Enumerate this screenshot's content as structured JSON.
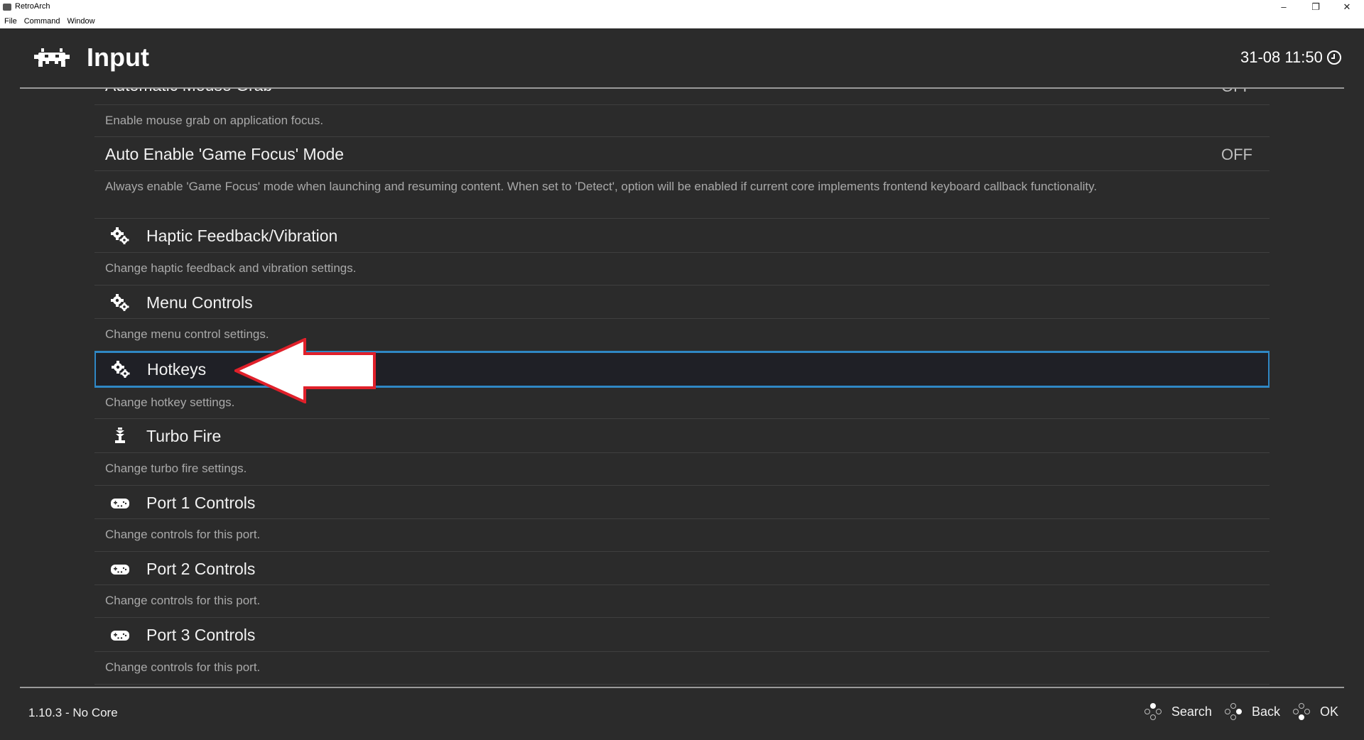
{
  "window": {
    "title": "RetroArch",
    "menu": [
      "File",
      "Command",
      "Window"
    ],
    "controls": {
      "minimize": "–",
      "maximize": "❐",
      "close": "✕"
    }
  },
  "header": {
    "title": "Input",
    "clock": "31-08 11:50",
    "logo_icon": "retroarch-invader-icon",
    "clock_icon": "clock-icon"
  },
  "list": {
    "items": [
      {
        "label": "Automatic Mouse Grab",
        "value": "OFF",
        "description": "Enable mouse grab on application focus.",
        "icon": null
      },
      {
        "label": "Auto Enable 'Game Focus' Mode",
        "value": "OFF",
        "description": "Always enable 'Game Focus' mode when launching and resuming content. When set to 'Detect', option will be enabled if current core implements frontend keyboard callback functionality.",
        "icon": null
      },
      {
        "label": "Haptic Feedback/Vibration",
        "description": "Change haptic feedback and vibration settings.",
        "icon": "gears-icon"
      },
      {
        "label": "Menu Controls",
        "description": "Change menu control settings.",
        "icon": "gears-icon"
      },
      {
        "label": "Hotkeys",
        "description": "Change hotkey settings.",
        "icon": "gears-icon",
        "selected": true
      },
      {
        "label": "Turbo Fire",
        "description": "Change turbo fire settings.",
        "icon": "turbo-icon"
      },
      {
        "label": "Port 1 Controls",
        "description": "Change controls for this port.",
        "icon": "gamepad-icon"
      },
      {
        "label": "Port 2 Controls",
        "description": "Change controls for this port.",
        "icon": "gamepad-icon"
      },
      {
        "label": "Port 3 Controls",
        "description": "Change controls for this port.",
        "icon": "gamepad-icon"
      }
    ]
  },
  "annotation": {
    "type": "red-outlined-arrow",
    "points_to": "Hotkeys",
    "colors": {
      "fill": "#ffffff",
      "stroke": "#e0202a"
    }
  },
  "footer": {
    "version": "1.10.3 - No Core",
    "actions": [
      {
        "label": "Search",
        "icon": "gamepad-button-top-icon"
      },
      {
        "label": "Back",
        "icon": "gamepad-button-right-icon"
      },
      {
        "label": "OK",
        "icon": "gamepad-button-bottom-icon"
      }
    ]
  },
  "colors": {
    "background": "#2b2b2b",
    "selection_border": "#2f87c4",
    "selection_bg": "#1f2026"
  }
}
